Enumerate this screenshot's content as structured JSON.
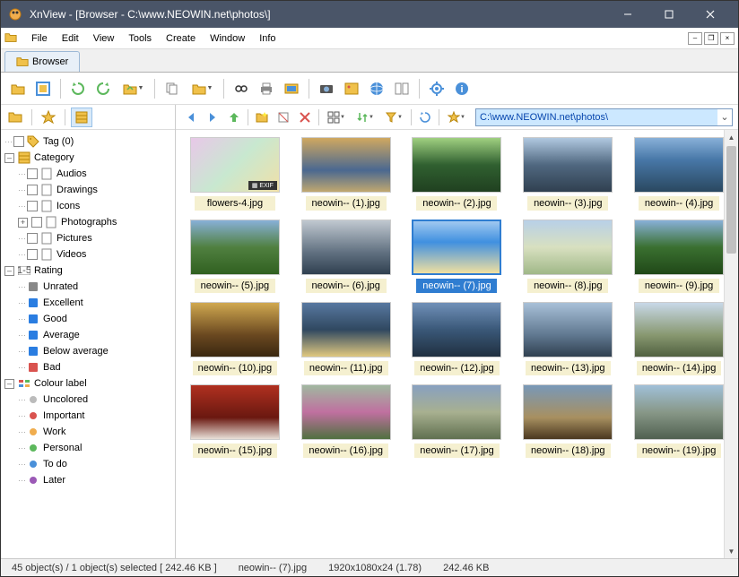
{
  "titlebar": {
    "title": "XnView - [Browser - C:\\www.NEOWIN.net\\photos\\]"
  },
  "menubar": {
    "items": [
      "File",
      "Edit",
      "View",
      "Tools",
      "Create",
      "Window",
      "Info"
    ]
  },
  "tab": {
    "label": "Browser"
  },
  "address": {
    "path": "C:\\www.NEOWIN.net\\photos\\"
  },
  "tree": {
    "tag": {
      "label": "Tag (0)"
    },
    "category": {
      "label": "Category",
      "children": [
        "Audios",
        "Drawings",
        "Icons",
        "Photographs",
        "Pictures",
        "Videos"
      ]
    },
    "rating": {
      "label": "Rating",
      "children": [
        "Unrated",
        "Excellent",
        "Good",
        "Average",
        "Below average",
        "Bad"
      ]
    },
    "colour": {
      "label": "Colour label",
      "children": [
        "Uncolored",
        "Important",
        "Work",
        "Personal",
        "To do",
        "Later"
      ]
    }
  },
  "thumbs": [
    {
      "label": "flowers-4.jpg",
      "selected": false,
      "exif": true,
      "cls": "tg1"
    },
    {
      "label": "neowin-- (1).jpg",
      "selected": false,
      "cls": "tg2"
    },
    {
      "label": "neowin-- (2).jpg",
      "selected": false,
      "cls": "tg3"
    },
    {
      "label": "neowin-- (3).jpg",
      "selected": false,
      "cls": "tg4"
    },
    {
      "label": "neowin-- (4).jpg",
      "selected": false,
      "cls": "tg5"
    },
    {
      "label": "neowin-- (5).jpg",
      "selected": false,
      "cls": "tg6"
    },
    {
      "label": "neowin-- (6).jpg",
      "selected": false,
      "cls": "tg7"
    },
    {
      "label": "neowin-- (7).jpg",
      "selected": true,
      "cls": "tg8"
    },
    {
      "label": "neowin-- (8).jpg",
      "selected": false,
      "cls": "tg9"
    },
    {
      "label": "neowin-- (9).jpg",
      "selected": false,
      "cls": "tg10"
    },
    {
      "label": "neowin-- (10).jpg",
      "selected": false,
      "cls": "tg11"
    },
    {
      "label": "neowin-- (11).jpg",
      "selected": false,
      "cls": "tg12"
    },
    {
      "label": "neowin-- (12).jpg",
      "selected": false,
      "cls": "tg13"
    },
    {
      "label": "neowin-- (13).jpg",
      "selected": false,
      "cls": "tg14"
    },
    {
      "label": "neowin-- (14).jpg",
      "selected": false,
      "cls": "tg15"
    },
    {
      "label": "neowin-- (15).jpg",
      "selected": false,
      "cls": "tg16"
    },
    {
      "label": "neowin-- (16).jpg",
      "selected": false,
      "cls": "tg17"
    },
    {
      "label": "neowin-- (17).jpg",
      "selected": false,
      "cls": "tg18"
    },
    {
      "label": "neowin-- (18).jpg",
      "selected": false,
      "cls": "tg19"
    },
    {
      "label": "neowin-- (19).jpg",
      "selected": false,
      "cls": "tg20"
    }
  ],
  "status": {
    "count": "45 object(s) / 1 object(s) selected  [ 242.46 KB ]",
    "name": "neowin-- (7).jpg",
    "dims": "1920x1080x24 (1.78)",
    "size": "242.46 KB"
  },
  "rating_colors": [
    "#888",
    "#2a7de1",
    "#2a7de1",
    "#2a7de1",
    "#2a7de1",
    "#d9534f"
  ],
  "label_colors": [
    "#bbb",
    "#d9534f",
    "#f0ad4e",
    "#5cb85c",
    "#4a90d9",
    "#9b59b6"
  ]
}
